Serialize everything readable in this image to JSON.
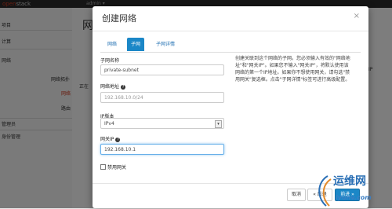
{
  "background": {
    "logo_brand": "open",
    "logo_rest": "stack",
    "user_chip": "admin ▾",
    "sidebar_items": [
      "项目",
      "计算",
      "网络",
      "网络拓扑",
      "网络",
      "路由",
      "管理员",
      "身份管理"
    ],
    "page_title": "网",
    "status_text": "正在",
    "right_labels": [
      "IP"
    ]
  },
  "modal": {
    "title": "创建网络",
    "close_icon": "×",
    "tabs": [
      "网络",
      "子网",
      "子网详情"
    ],
    "active_tab_index": 1,
    "subnet_name_label": "子网名称",
    "subnet_name_value": "private-subnet",
    "network_address_label": "网络地址",
    "network_address_placeholder": "192.168.10.0/24",
    "ip_version_label": "IP版本",
    "ip_version_value": "IPv4",
    "gateway_ip_label": "网关IP",
    "gateway_ip_value": "192.168.10.1",
    "disable_gateway_label": "禁用网关",
    "help_text": "创建关联到这个网络的子网。您必须输入有效的\"网络地址\"和\"网关IP\"。如果您不输入\"网关IP\"，将默认使用该网络的第一个IP地址。如果你不想使用网关，请勾选\"禁用网关\"复选框。点击\"子网详情\"标签可进行高级配置。",
    "cancel_label": "取消",
    "back_label": "« 后退",
    "next_label": "前进 »"
  },
  "watermark": {
    "line1": "运维网",
    "line2": "iyunv.com"
  },
  "colors": {
    "primary": "#1b87c7",
    "watermark": "#2a6fb5"
  }
}
